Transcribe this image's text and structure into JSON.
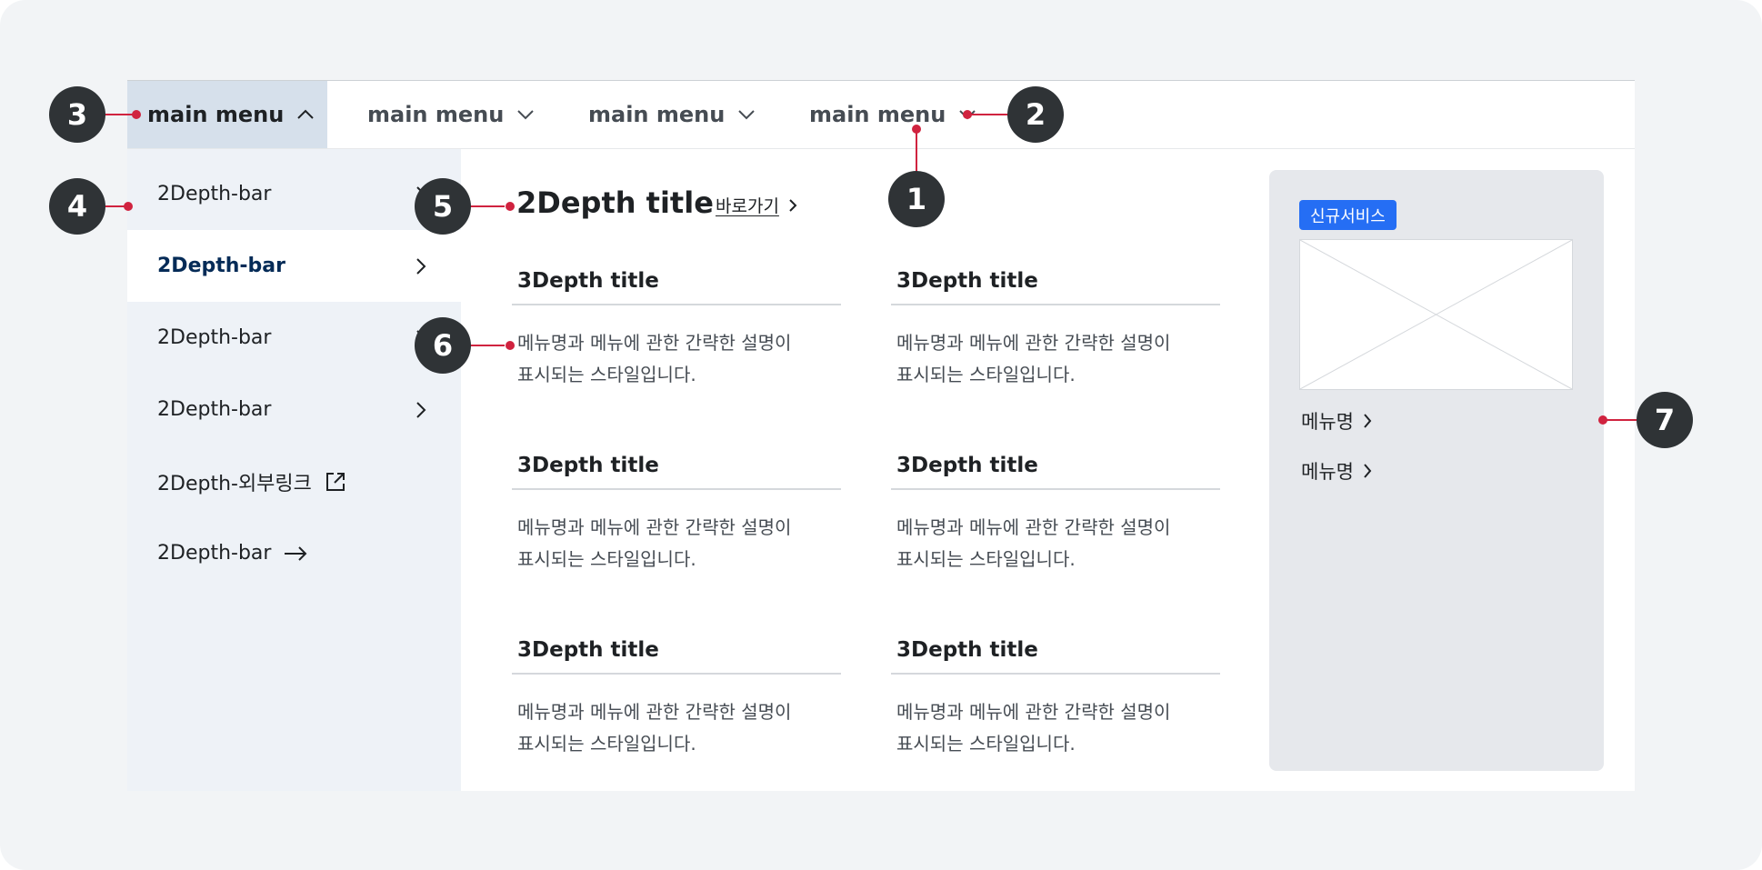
{
  "gnb": {
    "items": [
      {
        "label": "main menu",
        "state": "expanded"
      },
      {
        "label": "main menu",
        "state": "collapsed"
      },
      {
        "label": "main menu",
        "state": "collapsed"
      },
      {
        "label": "main menu",
        "state": "collapsed"
      }
    ]
  },
  "side": {
    "items": [
      {
        "label": "2Depth-bar",
        "icon": "chevron-right-icon"
      },
      {
        "label": "2Depth-bar",
        "icon": "chevron-right-icon",
        "active": true
      },
      {
        "label": "2Depth-bar",
        "icon": "chevron-right-icon"
      },
      {
        "label": "2Depth-bar",
        "icon": "chevron-right-icon"
      },
      {
        "label": "2Depth-외부링크",
        "icon": "external-link-icon"
      },
      {
        "label": "2Depth-bar",
        "icon": "arrow-right-icon"
      }
    ]
  },
  "content": {
    "title": "2Depth title",
    "shortcut_label": "바로가기",
    "cards": [
      {
        "title": "3Depth title",
        "desc_line1": "메뉴명과 메뉴에 관한 간략한 설명이",
        "desc_line2": "표시되는 스타일입니다."
      },
      {
        "title": "3Depth title",
        "desc_line1": "메뉴명과 메뉴에 관한 간략한 설명이",
        "desc_line2": "표시되는 스타일입니다."
      },
      {
        "title": "3Depth title",
        "desc_line1": "메뉴명과 메뉴에 관한 간략한 설명이",
        "desc_line2": "표시되는 스타일입니다."
      },
      {
        "title": "3Depth title",
        "desc_line1": "메뉴명과 메뉴에 관한 간략한 설명이",
        "desc_line2": "표시되는 스타일입니다."
      },
      {
        "title": "3Depth title",
        "desc_line1": "메뉴명과 메뉴에 관한 간략한 설명이",
        "desc_line2": "표시되는 스타일입니다."
      },
      {
        "title": "3Depth title",
        "desc_line1": "메뉴명과 메뉴에 관한 간략한 설명이",
        "desc_line2": "표시되는 스타일입니다."
      }
    ]
  },
  "panel": {
    "badge": "신규서비스",
    "links": [
      "메뉴명",
      "메뉴명"
    ]
  },
  "markers": [
    "1",
    "2",
    "3",
    "4",
    "5",
    "6",
    "7"
  ],
  "colors": {
    "canvas_bg": "#f2f4f6",
    "gnb_active_bg": "#d6e0eb",
    "side_bg": "#eef2f7",
    "side_active_text": "#052b57",
    "panel_bg": "#e6e8ec",
    "badge_bg": "#256ef4",
    "marker_bg": "#2f3336",
    "marker_line": "#d0233f"
  }
}
